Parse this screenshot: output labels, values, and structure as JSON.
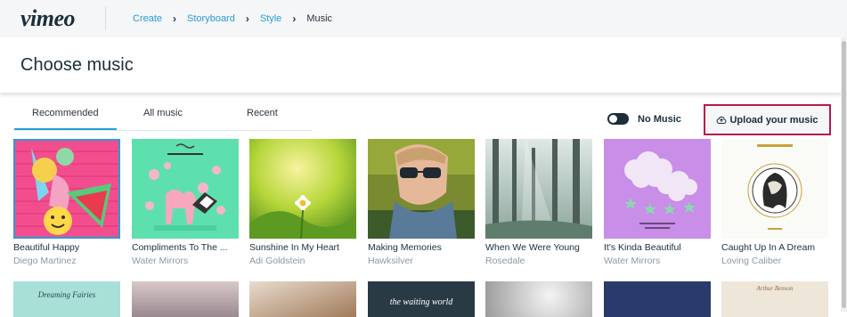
{
  "header": {
    "logo": "vimeo",
    "breadcrumb": [
      "Create",
      "Storyboard",
      "Style"
    ],
    "breadcrumb_current": "Music",
    "separator": "›"
  },
  "page": {
    "title": "Choose music"
  },
  "tabs": [
    {
      "label": "Recommended",
      "active": true
    },
    {
      "label": "All music",
      "active": false
    },
    {
      "label": "Recent",
      "active": false
    }
  ],
  "controls": {
    "no_music_label": "No Music",
    "no_music_on": false,
    "upload_label": "Upload your music"
  },
  "tracks": [
    {
      "title": "Beautiful Happy",
      "artist": "Diego Martinez",
      "selected": true
    },
    {
      "title": "Compliments To The ...",
      "artist": "Water Mirrors",
      "selected": false
    },
    {
      "title": "Sunshine In My Heart",
      "artist": "Adi Goldstein",
      "selected": false
    },
    {
      "title": "Making Memories",
      "artist": "Hawksilver",
      "selected": false
    },
    {
      "title": "When We Were Young",
      "artist": "Rosedale",
      "selected": false
    },
    {
      "title": "It's Kinda Beautiful",
      "artist": "Water Mirrors",
      "selected": false
    },
    {
      "title": "Caught Up In A Dream",
      "artist": "Loving Caliber",
      "selected": false
    }
  ],
  "row2_art_text": [
    "Dreaming Fairies",
    "",
    "",
    "the waiting world",
    "",
    "",
    "Arthur Benson"
  ],
  "colors": {
    "accent": "#2a9cd6",
    "highlight_border": "#b5194d",
    "text": "#1a2e3b",
    "muted": "#8a99a5"
  }
}
